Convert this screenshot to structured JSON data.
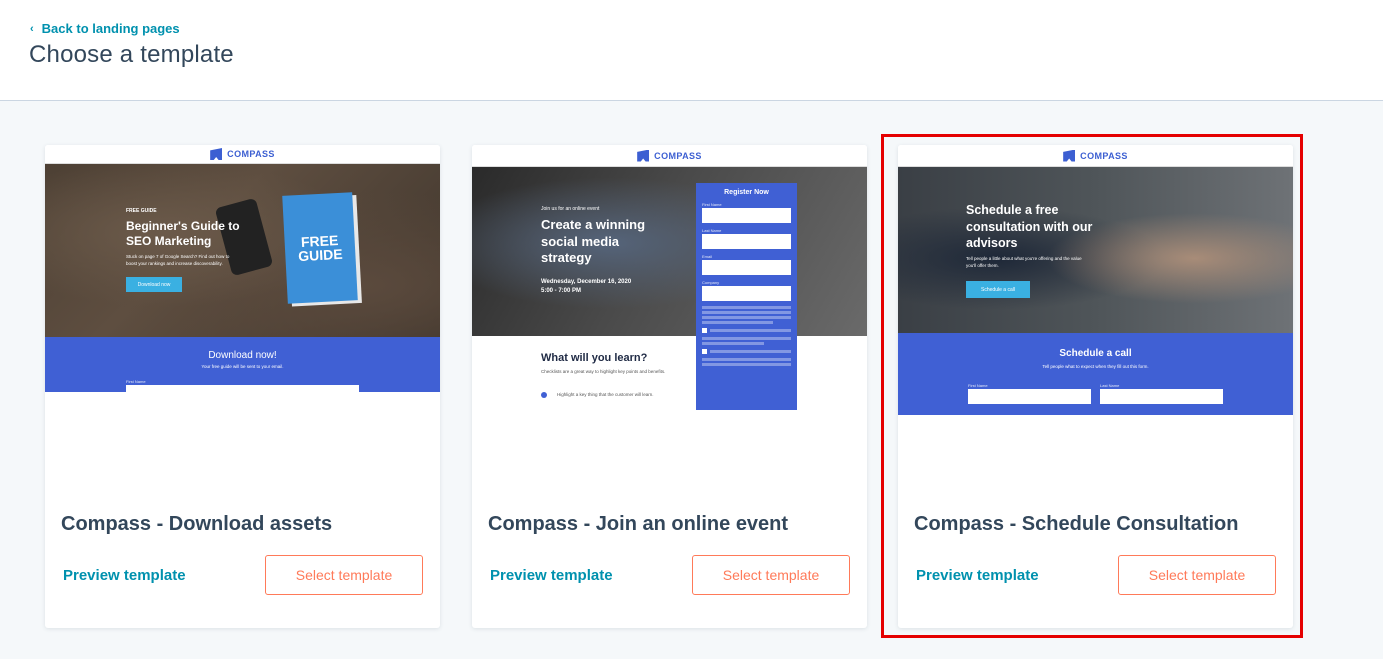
{
  "header": {
    "back_label": "Back to landing pages",
    "back_icon": "chevron-left-icon",
    "title": "Choose a template"
  },
  "colors": {
    "link": "#0091ae",
    "accent_button": "#ff7a59",
    "text": "#33475b",
    "brand_blue": "#4060d4",
    "selection_outline": "#e50000"
  },
  "cards": [
    {
      "name": "Compass - Download assets",
      "preview_label": "Preview template",
      "select_label": "Select template",
      "selected": false,
      "thumbnail": {
        "brand": "COMPASS",
        "eyebrow": "FREE GUIDE",
        "headline": "Beginner's Guide to SEO Marketing",
        "body": "Stuck on page 7 of Google Search? Find out how to boost your rankings and increase discoverability.",
        "cta": "Download now",
        "book_text": "FREE GUIDE",
        "form_title": "Download now!",
        "form_subtitle": "Your free guide will be sent to your email.",
        "field_label": "First Name"
      }
    },
    {
      "name": "Compass - Join an online event",
      "preview_label": "Preview template",
      "select_label": "Select template",
      "selected": false,
      "thumbnail": {
        "brand": "COMPASS",
        "eyebrow": "Join us for an online event",
        "headline": "Create a winning social media strategy",
        "date": "Wednesday, December 16, 2020",
        "time": "5:00 - 7:00 PM",
        "form_title": "Register Now",
        "fields": [
          "First Name",
          "Last Name",
          "Email",
          "Company"
        ],
        "section_title": "What will you learn?",
        "section_body": "Checklists are a great way to highlight key points and benefits.",
        "checklist_item": "Highlight a key thing that the customer will learn."
      }
    },
    {
      "name": "Compass - Schedule Consultation",
      "preview_label": "Preview template",
      "select_label": "Select template",
      "selected": true,
      "thumbnail": {
        "brand": "COMPASS",
        "headline": "Schedule a free consultation with our advisors",
        "body": "Tell people a little about what you're offering and the value you'll offer them.",
        "cta": "Schedule a call",
        "form_title": "Schedule a call",
        "form_subtitle": "Tell people what to expect when they fill out this form.",
        "fields": [
          "First Name",
          "Last Name"
        ]
      }
    }
  ]
}
